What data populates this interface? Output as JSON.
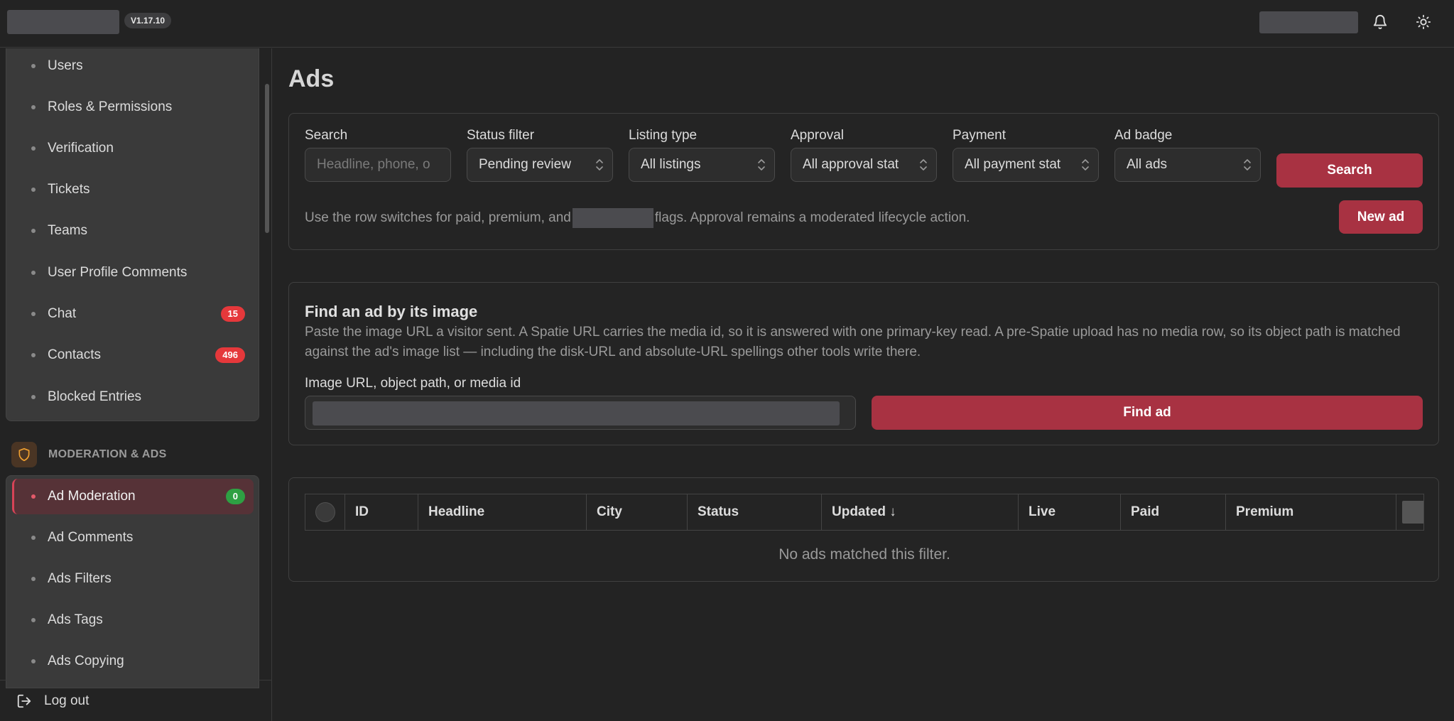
{
  "header": {
    "version": "V1.17.10"
  },
  "sidebar": {
    "items": [
      {
        "label": "Users"
      },
      {
        "label": "Roles & Permissions"
      },
      {
        "label": "Verification"
      },
      {
        "label": "Tickets"
      },
      {
        "label": "Teams"
      },
      {
        "label": "User Profile Comments"
      },
      {
        "label": "Chat",
        "badge": "15"
      },
      {
        "label": "Contacts",
        "badge": "496"
      },
      {
        "label": "Blocked Entries"
      }
    ],
    "section_title": "MODERATION & ADS",
    "section_items": [
      {
        "label": "Ad Moderation",
        "badge": "0",
        "active": true
      },
      {
        "label": "Ad Comments"
      },
      {
        "label": "Ads Filters"
      },
      {
        "label": "Ads Tags"
      },
      {
        "label": "Ads Copying"
      }
    ],
    "logout_label": "Log out"
  },
  "page": {
    "title": "Ads"
  },
  "filters": {
    "search": {
      "label": "Search",
      "placeholder": "Headline, phone, o"
    },
    "status": {
      "label": "Status filter",
      "value": "Pending review"
    },
    "listing": {
      "label": "Listing type",
      "value": "All listings"
    },
    "approval": {
      "label": "Approval",
      "value": "All approval stat"
    },
    "payment": {
      "label": "Payment",
      "value": "All payment stat"
    },
    "badge": {
      "label": "Ad badge",
      "value": "All ads"
    },
    "search_button": "Search",
    "new_button": "New ad",
    "hint_before": "Use the row switches for paid, premium, and",
    "hint_after": "flags. Approval remains a moderated lifecycle action."
  },
  "image_finder": {
    "title": "Find an ad by its image",
    "description": "Paste the image URL a visitor sent. A Spatie URL carries the media id, so it is answered with one primary-key read. A pre-Spatie upload has no media row, so its object path is matched against the ad's image list — including the disk-URL and absolute-URL spellings other tools write there.",
    "input_label": "Image URL, object path, or media id",
    "button": "Find ad"
  },
  "table": {
    "columns": [
      "ID",
      "Headline",
      "City",
      "Status",
      "Updated ↓",
      "Live",
      "Paid",
      "Premium"
    ],
    "empty_text": "No ads matched this filter."
  },
  "colors": {
    "accent": "#a83242",
    "badge_red": "#e5383b",
    "badge_green": "#2ea043"
  }
}
